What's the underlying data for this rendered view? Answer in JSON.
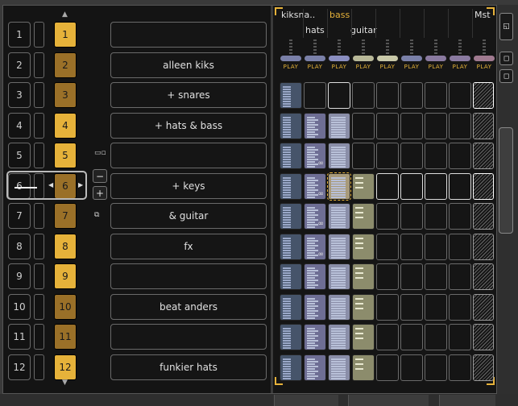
{
  "rows": [
    {
      "num": "1",
      "gold": "1",
      "gold_style": "hi",
      "scene": ""
    },
    {
      "num": "2",
      "gold": "2",
      "gold_style": "lo",
      "scene": "alleen kiks"
    },
    {
      "num": "3",
      "gold": "3",
      "gold_style": "lo",
      "scene": "+ snares"
    },
    {
      "num": "4",
      "gold": "4",
      "gold_style": "hi",
      "scene": "+ hats & bass"
    },
    {
      "num": "5",
      "gold": "5",
      "gold_style": "hi",
      "scene": ""
    },
    {
      "num": "6",
      "gold": "6",
      "gold_style": "lo",
      "scene": "+ keys"
    },
    {
      "num": "7",
      "gold": "7",
      "gold_style": "lo",
      "scene": "& guitar"
    },
    {
      "num": "8",
      "gold": "8",
      "gold_style": "hi",
      "scene": "fx"
    },
    {
      "num": "9",
      "gold": "9",
      "gold_style": "hi",
      "scene": ""
    },
    {
      "num": "10",
      "gold": "10",
      "gold_style": "lo",
      "scene": "beat anders"
    },
    {
      "num": "11",
      "gold": "11",
      "gold_style": "lo",
      "scene": ""
    },
    {
      "num": "12",
      "gold": "12",
      "gold_style": "hi",
      "scene": "funkier hats"
    }
  ],
  "side": {
    "minus": "−",
    "plus": "+"
  },
  "tracks": {
    "t1": "kiksna..",
    "t2": "hats",
    "t3": "bass",
    "t4": "guitar",
    "master": "Mst",
    "play": "PLAY",
    "colors": [
      "#7a80a8",
      "#7a80a8",
      "#8a8ec0",
      "#b8b898",
      "#c8c8a8",
      "#7a80a8",
      "#8a7aa0",
      "#8a7aa0",
      "#a07a90"
    ]
  },
  "clips": [
    [
      0,
      null,
      "hl",
      null,
      null,
      null,
      null,
      null
    ],
    [
      0,
      1,
      2,
      null,
      null,
      null,
      null,
      null
    ],
    [
      0,
      "1i",
      2,
      null,
      null,
      null,
      null,
      null
    ],
    [
      0,
      "1i",
      "2s",
      3,
      "hl",
      "hl",
      "hl",
      "hl"
    ],
    [
      0,
      "1i",
      2,
      3,
      null,
      null,
      null,
      null
    ],
    [
      0,
      "1i",
      2,
      3,
      null,
      null,
      null,
      null
    ],
    [
      0,
      1,
      2,
      3,
      null,
      null,
      null,
      null
    ],
    [
      0,
      1,
      2,
      3,
      null,
      null,
      null,
      null
    ],
    [
      0,
      1,
      2,
      3,
      null,
      null,
      null,
      null
    ],
    [
      0,
      1,
      2,
      3,
      null,
      null,
      null,
      null
    ]
  ],
  "scrollbar": {
    "b1": "◱",
    "b2": "◻",
    "b3": "◻"
  }
}
